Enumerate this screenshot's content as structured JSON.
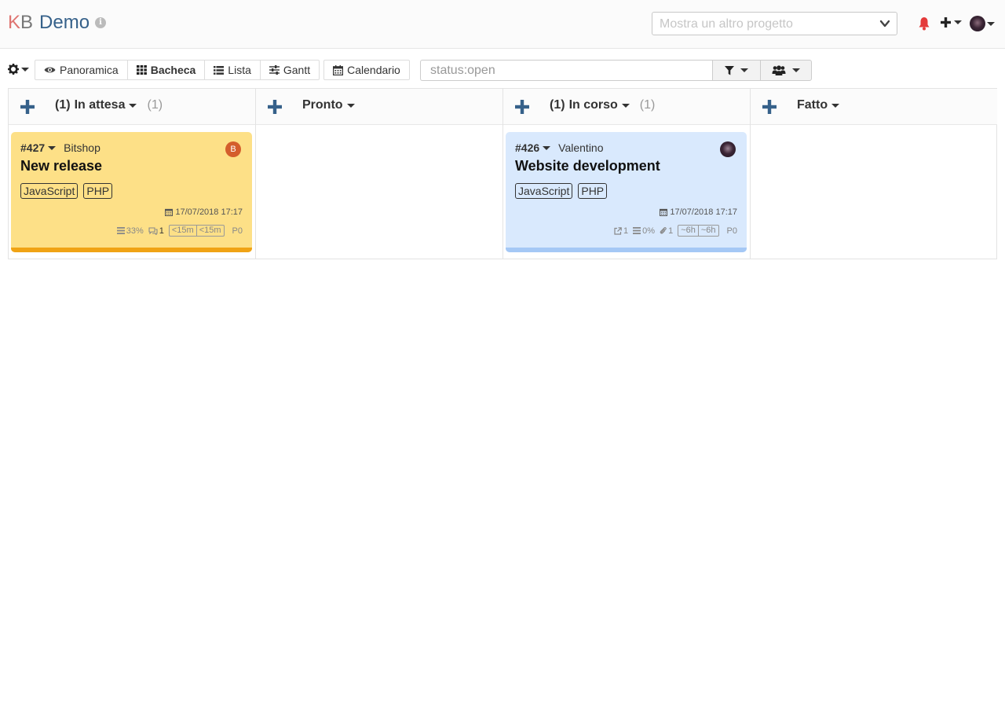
{
  "header": {
    "logo_k": "K",
    "logo_b": "B",
    "project_name": "Demo",
    "project_select_placeholder": "Mostra un altro progetto"
  },
  "toolbar": {
    "views": [
      {
        "label": "Panoramica",
        "icon": "eye-icon"
      },
      {
        "label": "Bacheca",
        "icon": "grid-icon",
        "active": true
      },
      {
        "label": "Lista",
        "icon": "list-icon"
      },
      {
        "label": "Gantt",
        "icon": "sliders-icon"
      },
      {
        "label": "Calendario",
        "icon": "calendar-icon"
      }
    ],
    "search_value": "status:open"
  },
  "columns": [
    {
      "prefix": "(1)",
      "name": "In attesa",
      "count": "(1)"
    },
    {
      "prefix": "",
      "name": "Pronto",
      "count": ""
    },
    {
      "prefix": "(1)",
      "name": "In corso",
      "count": "(1)"
    },
    {
      "prefix": "",
      "name": "Fatto",
      "count": ""
    }
  ],
  "cards": [
    {
      "id": "#427",
      "owner": "Bitshop",
      "avatar_letter": "B",
      "title": "New release",
      "tags": [
        "JavaScript",
        "PHP"
      ],
      "date": "17/07/2018 17:17",
      "subtasks": "33%",
      "comments": "1",
      "time_estimated": "<15m",
      "time_spent": "<15m",
      "priority": "P0",
      "color": "#fde087"
    },
    {
      "id": "#426",
      "owner": "Valentino",
      "title": "Website development",
      "tags": [
        "JavaScript",
        "PHP"
      ],
      "date": "17/07/2018 17:17",
      "links": "1",
      "subtasks": "0%",
      "attachments": "1",
      "time_estimated": "~6h",
      "time_spent": "~6h",
      "priority": "P0",
      "color": "#d9e9fd"
    }
  ],
  "colors": {
    "brand_blue": "#36618a",
    "bell_red": "#e43a3a",
    "plus_blue": "#36618a"
  }
}
